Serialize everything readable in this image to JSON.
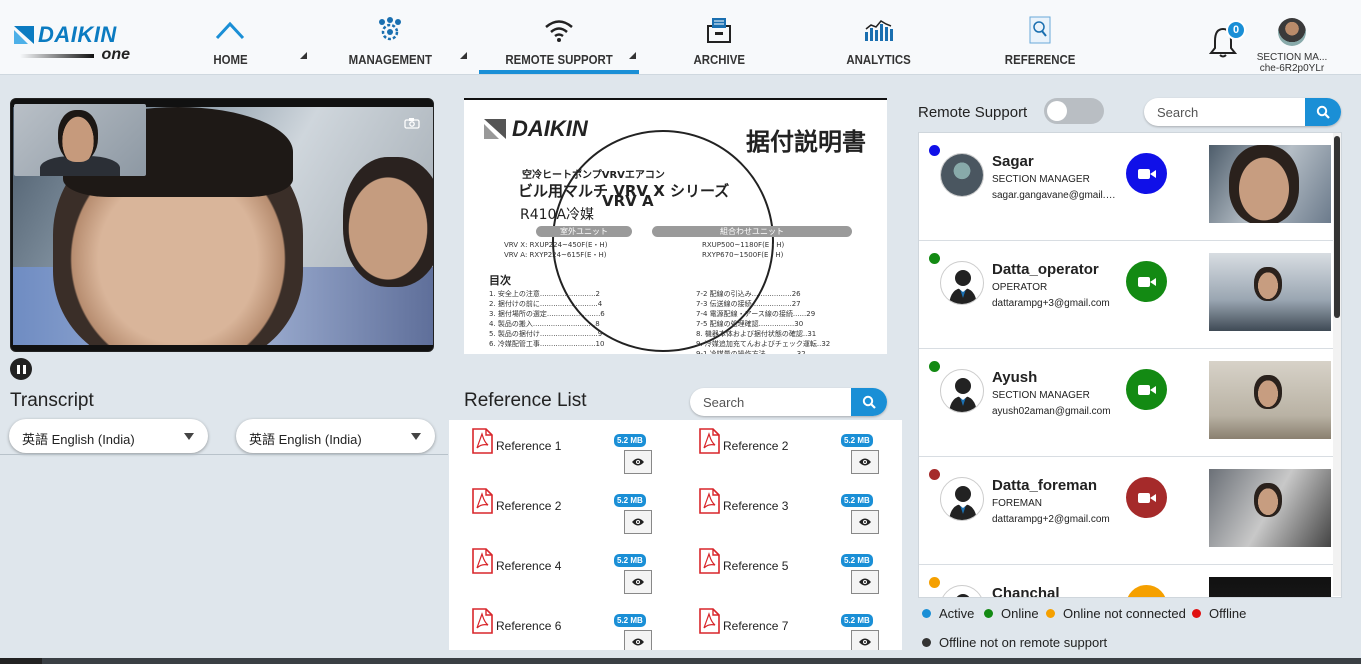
{
  "header": {
    "brand": "DAIKIN",
    "brand_sub": "one",
    "nav": [
      {
        "label": "HOME",
        "icon": "home-chevron-icon"
      },
      {
        "label": "MANAGEMENT",
        "icon": "gear-users-icon"
      },
      {
        "label": "REMOTE SUPPORT",
        "icon": "wifi-icon"
      },
      {
        "label": "ARCHIVE",
        "icon": "archive-icon"
      },
      {
        "label": "ANALYTICS",
        "icon": "analytics-chart-icon"
      },
      {
        "label": "REFERENCE",
        "icon": "reference-search-icon"
      }
    ],
    "notification_count": "0",
    "user_role": "SECTION MA...",
    "user_id": "che-6R2p0YLr"
  },
  "transcript": {
    "title": "Transcript",
    "lang_left": "英語 English (India)",
    "lang_right": "英語 English (India)"
  },
  "document": {
    "brand": "DAIKIN",
    "title_jp": "据付説明書",
    "line1": "空冷ヒートポンプVRVエアコン",
    "line2": "ビル用マルチ VRV X シリーズ",
    "line2b": "VRV A",
    "line3": "R410A冷媒",
    "pill_left": "室外ユニット",
    "pill_right": "組合わせユニット",
    "models_left": "VRV X: RXUP224~450F(E・H)\nVRV A: RXYP224~615F(E・H)",
    "models_right": "RXUP500~1180F(E・H)\nRXYP670~1500F(E・H)",
    "toc_title": "目次",
    "toc_left": "1. 安全上の注意.........................2\n2. 据付けの前に..........................4\n3. 据付場所の選定........................6\n4. 製品の搬入............................8\n5. 製品の据付け..........................9\n6. 冷媒配管工事.........................10",
    "toc_right": "7-2 配線の引込み..................26\n7-3 伝送線の接続..................27\n7-4 電源配線・アース線の接続......29\n7-5 配線の処理確認................30\n8. 機器本体および据付状態の確認..31\n9. 冷媒追加充てんおよびチェック運転..32\n9-1 冷媒量の操作方法..............32"
  },
  "reference": {
    "title": "Reference List",
    "search_placeholder": "Search",
    "items": [
      {
        "name": "Reference 1",
        "size": "5.2 MB"
      },
      {
        "name": "Reference 2",
        "size": "5.2 MB"
      },
      {
        "name": "Reference 2",
        "size": "5.2 MB"
      },
      {
        "name": "Reference 3",
        "size": "5.2 MB"
      },
      {
        "name": "Reference 4",
        "size": "5.2 MB"
      },
      {
        "name": "Reference 5",
        "size": "5.2 MB"
      },
      {
        "name": "Reference 6",
        "size": "5.2 MB"
      },
      {
        "name": "Reference 7",
        "size": "5.2 MB"
      }
    ]
  },
  "remote": {
    "label": "Remote Support",
    "toggle_on": false,
    "search_placeholder": "Search",
    "users": [
      {
        "name": "Sagar",
        "role": "SECTION MANAGER",
        "email": "sagar.gangavane@gmail.com",
        "status_color": "#1010e8",
        "call_color": "#1010e8"
      },
      {
        "name": "Datta_operator",
        "role": "OPERATOR",
        "email": "dattarampg+3@gmail.com",
        "status_color": "#138a13",
        "call_color": "#138a13"
      },
      {
        "name": "Ayush",
        "role": "SECTION MANAGER",
        "email": "ayush02aman@gmail.com",
        "status_color": "#138a13",
        "call_color": "#138a13"
      },
      {
        "name": "Datta_foreman",
        "role": "FOREMAN",
        "email": "dattarampg+2@gmail.com",
        "status_color": "#a52a2a",
        "call_color": "#a52a2a"
      },
      {
        "name": "Chanchal",
        "role": "",
        "email": "",
        "status_color": "#f5a000",
        "call_color": "#f5a000"
      }
    ],
    "legend": [
      {
        "label": "Active",
        "color": "#1a8fd6"
      },
      {
        "label": "Online",
        "color": "#138a13"
      },
      {
        "label": "Online not connected",
        "color": "#f5a000"
      },
      {
        "label": "Offline",
        "color": "#e01010"
      },
      {
        "label": "Offline not on remote support",
        "color": "#333333"
      }
    ]
  },
  "colors": {
    "accent": "#1a8fd6",
    "brand": "#0b7bc1"
  }
}
